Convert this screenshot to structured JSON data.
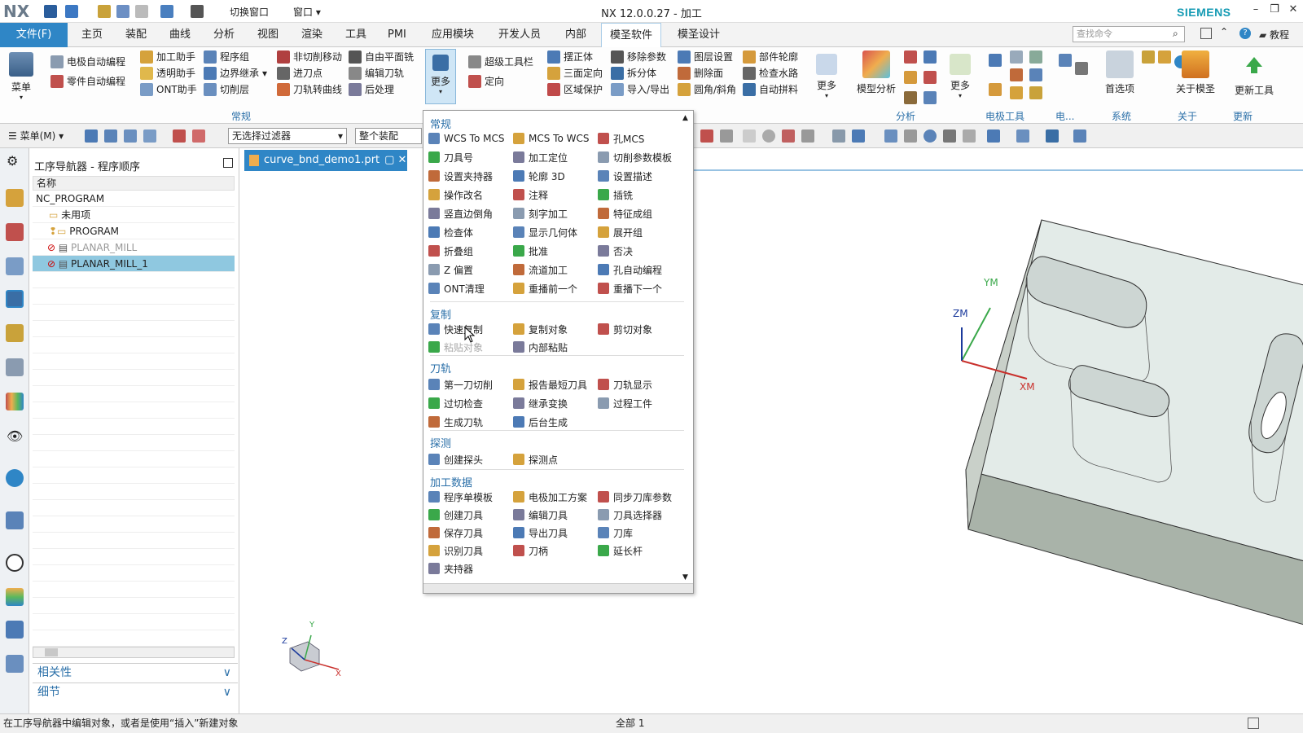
{
  "app": {
    "logo": "NX",
    "title": "NX 12.0.0.27 - 加工",
    "brand": "SIEMENS"
  },
  "quick_access": {
    "switch_window": "切换窗口",
    "window_menu": "窗口"
  },
  "menu_tabs": {
    "file": "文件(F)",
    "tabs": [
      "主页",
      "装配",
      "曲线",
      "分析",
      "视图",
      "渲染",
      "工具",
      "PMI",
      "应用模块",
      "开发人员",
      "内部",
      "模圣软件",
      "模圣设计"
    ],
    "active": "模圣软件"
  },
  "search": {
    "placeholder": "查找命令"
  },
  "help_label": "教程",
  "ribbon": {
    "menu_label": "菜单",
    "col1": [
      "电极自动编程",
      "零件自动编程"
    ],
    "col2": [
      "加工助手",
      "透明助手",
      "ONT助手"
    ],
    "col3": [
      "程序组",
      "边界继承",
      "切削层"
    ],
    "col4": [
      "非切削移动",
      "进刀点",
      "刀轨转曲线"
    ],
    "col5": [
      "自由平面铣",
      "编辑刀轨",
      "后处理"
    ],
    "more": "更多",
    "group_common": "常规",
    "col6": [
      "超级工具栏",
      "定向"
    ],
    "col7": [
      "摆正体",
      "三面定向",
      "区域保护"
    ],
    "col8": [
      "移除参数",
      "拆分体",
      "导入/导出"
    ],
    "col9": [
      "图层设置",
      "删除面",
      "圆角/斜角"
    ],
    "col10": [
      "部件轮廓",
      "检查水路",
      "自动拼料"
    ],
    "more2": "更多",
    "model_analysis": "模型分析",
    "more3": "更多",
    "group_analysis": "分析",
    "group_electrode": "电极工具",
    "group_e2": "电...",
    "preferences": "首选项",
    "group_system": "系统",
    "about": "关于模圣",
    "group_about": "关于",
    "update_tool": "更新工具",
    "group_update": "更新"
  },
  "toolbar2": {
    "menu": "菜单(M)",
    "filter": "无选择过滤器",
    "assembly": "整个装配"
  },
  "navigator": {
    "title": "工序导航器 - 程序顺序",
    "col_name": "名称",
    "rows": [
      "NC_PROGRAM",
      "未用项",
      "PROGRAM",
      "PLANAR_MILL",
      "PLANAR_MILL_1"
    ],
    "selected": "PLANAR_MILL_1",
    "pane_relevance": "相关性",
    "pane_details": "细节"
  },
  "document_tab": "curve_bnd_demo1.prt",
  "axes": {
    "ym": "YM",
    "zm": "ZM",
    "xm": "XM",
    "y": "Y",
    "x": "X",
    "z": "Z"
  },
  "dropdown": {
    "sections": {
      "common": "常规",
      "copy": "复制",
      "toolpath": "刀轨",
      "probe": "探测",
      "data": "加工数据"
    },
    "common": [
      [
        "WCS To MCS",
        "MCS To WCS",
        "孔MCS"
      ],
      [
        "刀具号",
        "加工定位",
        "切削参数模板"
      ],
      [
        "设置夹持器",
        "轮廓 3D",
        "设置描述"
      ],
      [
        "操作改名",
        "注释",
        "插铣"
      ],
      [
        "竖直边倒角",
        "刻字加工",
        "特征成组"
      ],
      [
        "检查体",
        "显示几何体",
        "展开组"
      ],
      [
        "折叠组",
        "批准",
        "否决"
      ],
      [
        "Z 偏置",
        "流道加工",
        "孔自动编程"
      ],
      [
        "ONT清理",
        "重播前一个",
        "重播下一个"
      ]
    ],
    "copy": [
      [
        "快速复制",
        "复制对象",
        "剪切对象"
      ],
      [
        "粘贴对象",
        "内部粘贴",
        ""
      ]
    ],
    "toolpath": [
      [
        "第一刀切削",
        "报告最短刀具",
        "刀轨显示"
      ],
      [
        "过切检查",
        "继承变换",
        "过程工件"
      ],
      [
        "生成刀轨",
        "后台生成",
        ""
      ]
    ],
    "probe": [
      [
        "创建探头",
        "探测点",
        ""
      ]
    ],
    "data": [
      [
        "程序单模板",
        "电极加工方案",
        "同步刀库参数"
      ],
      [
        "创建刀具",
        "编辑刀具",
        "刀具选择器"
      ],
      [
        "保存刀具",
        "导出刀具",
        "刀库"
      ],
      [
        "识别刀具",
        "刀柄",
        "延长杆"
      ],
      [
        "夹持器",
        "",
        ""
      ]
    ]
  },
  "status": {
    "message": "在工序导航器中编辑对象，或者是使用“插入”新建对象",
    "center": "全部 1"
  },
  "colors": {
    "accent": "#2f86c6",
    "selected_row": "#8fc8e0",
    "section": "#2a6fa8"
  }
}
